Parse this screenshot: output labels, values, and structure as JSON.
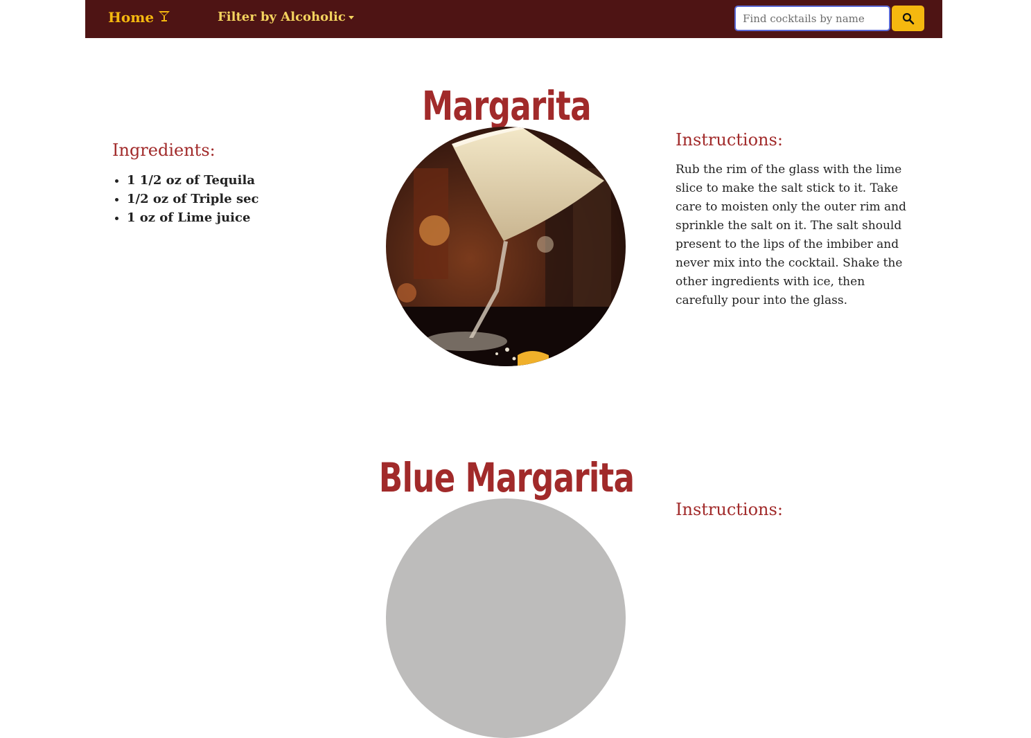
{
  "nav": {
    "home_label": "Home",
    "filter_label": "Filter by Alcoholic",
    "search_placeholder": "Find cocktails by name",
    "home_icon": "cocktail-glass-icon",
    "search_icon": "search-icon",
    "colors": {
      "navbar_bg": "#4e1414",
      "accent": "#f5b80f"
    }
  },
  "drinks": [
    {
      "name": "Margarita",
      "ingredients_heading": "Ingredients:",
      "ingredients": [
        "1 1/2 oz of Tequila",
        "1/2 oz of Triple sec",
        "1 oz of Lime juice"
      ],
      "instructions_heading": "Instructions:",
      "instructions": "Rub the rim of the glass with the lime slice to make the salt stick to it. Take care to moisten only the outer rim and sprinkle the salt on it. The salt should present to the lips of the imbiber and never mix into the cocktail. Shake the other ingredients with ice, then carefully pour into the glass."
    },
    {
      "name": "Blue Margarita",
      "instructions_heading": "Instructions:"
    }
  ]
}
